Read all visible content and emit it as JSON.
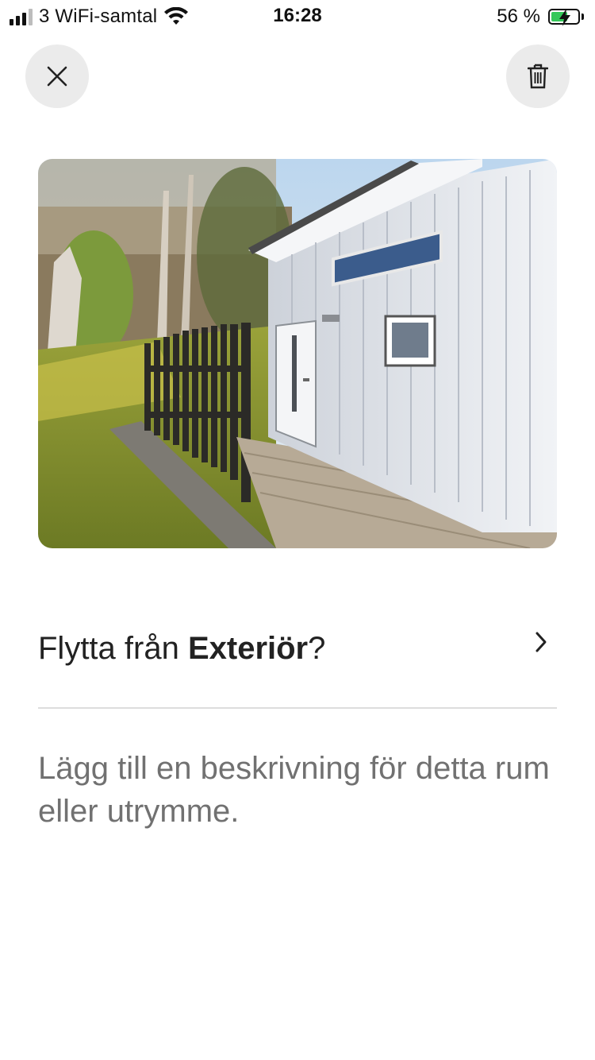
{
  "status_bar": {
    "carrier": "3 WiFi-samtal",
    "time": "16:28",
    "battery_percent": "56 %",
    "battery_color": "#34c759",
    "icons": [
      "signal-icon",
      "wifi-icon",
      "battery-charging-icon"
    ]
  },
  "header": {
    "close_icon": "close-icon",
    "delete_icon": "trash-icon"
  },
  "photo": {
    "description": "house-exterior-photo"
  },
  "move_row": {
    "prefix": "Flytta från ",
    "room": "Exteriör",
    "suffix": "?",
    "icon": "chevron-right-icon"
  },
  "description": {
    "placeholder": "Lägg till en beskrivning för detta rum eller utrymme."
  }
}
